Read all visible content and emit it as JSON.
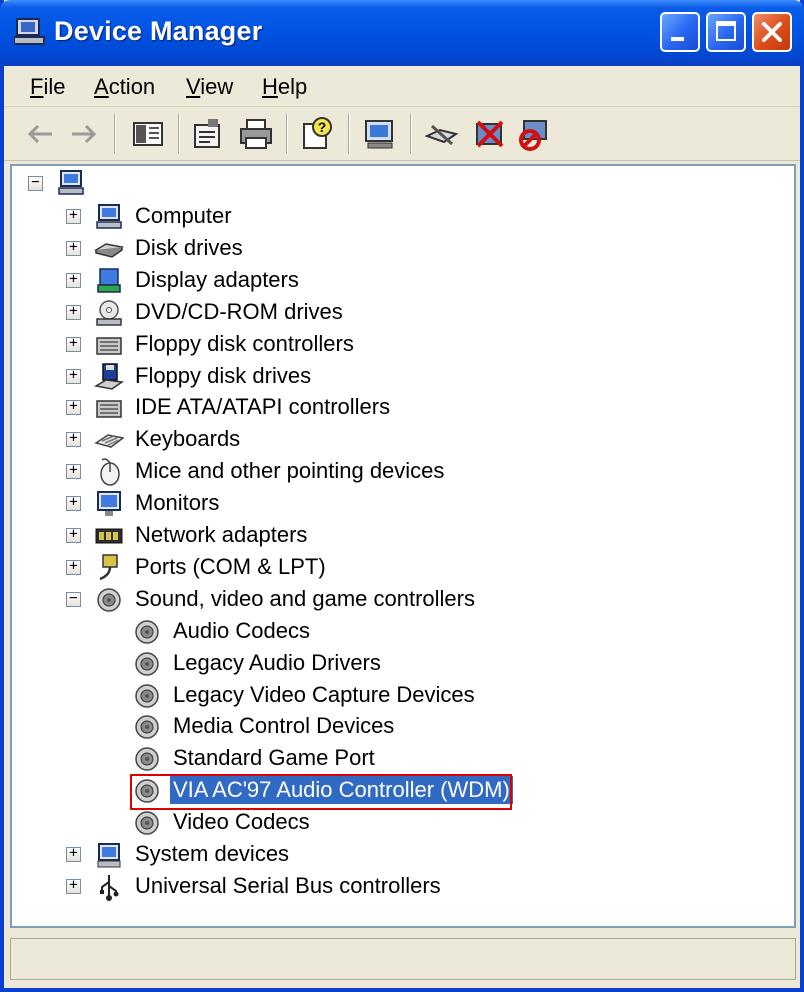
{
  "window": {
    "title": "Device Manager",
    "accent": "#0054e3",
    "selection_color": "#316ac5",
    "highlight_border": "#e00000"
  },
  "menu": [
    "File",
    "Action",
    "View",
    "Help"
  ],
  "toolbar": {
    "buttons": [
      "back-icon",
      "forward-icon",
      "show-hide-tree-icon",
      "properties-icon",
      "print-icon",
      "help-icon",
      "scan-hardware-icon",
      "update-driver-icon",
      "uninstall-icon",
      "disable-icon"
    ]
  },
  "tree": {
    "root_icon": "computer-icon",
    "categories": [
      {
        "label": "Computer",
        "icon": "computer-icon"
      },
      {
        "label": "Disk drives",
        "icon": "disk-drive-icon"
      },
      {
        "label": "Display adapters",
        "icon": "display-adapter-icon"
      },
      {
        "label": "DVD/CD-ROM drives",
        "icon": "cdrom-icon"
      },
      {
        "label": "Floppy disk controllers",
        "icon": "controller-icon"
      },
      {
        "label": "Floppy disk drives",
        "icon": "floppy-icon"
      },
      {
        "label": "IDE ATA/ATAPI controllers",
        "icon": "controller-icon"
      },
      {
        "label": "Keyboards",
        "icon": "keyboard-icon"
      },
      {
        "label": "Mice and other pointing devices",
        "icon": "mouse-icon"
      },
      {
        "label": "Monitors",
        "icon": "monitor-icon"
      },
      {
        "label": "Network adapters",
        "icon": "network-icon"
      },
      {
        "label": "Ports (COM & LPT)",
        "icon": "port-icon"
      },
      {
        "label": "Sound, video and game controllers",
        "icon": "speaker-icon",
        "expanded": true
      },
      {
        "label": "System devices",
        "icon": "system-icon"
      },
      {
        "label": "Universal Serial Bus controllers",
        "icon": "usb-icon"
      }
    ],
    "sound_children": [
      {
        "label": "Audio Codecs"
      },
      {
        "label": "Legacy Audio Drivers"
      },
      {
        "label": "Legacy Video Capture Devices"
      },
      {
        "label": "Media Control Devices"
      },
      {
        "label": "Standard Game Port"
      },
      {
        "label": "VIA AC'97 Audio Controller (WDM)",
        "selected": true
      },
      {
        "label": "Video Codecs"
      }
    ]
  }
}
